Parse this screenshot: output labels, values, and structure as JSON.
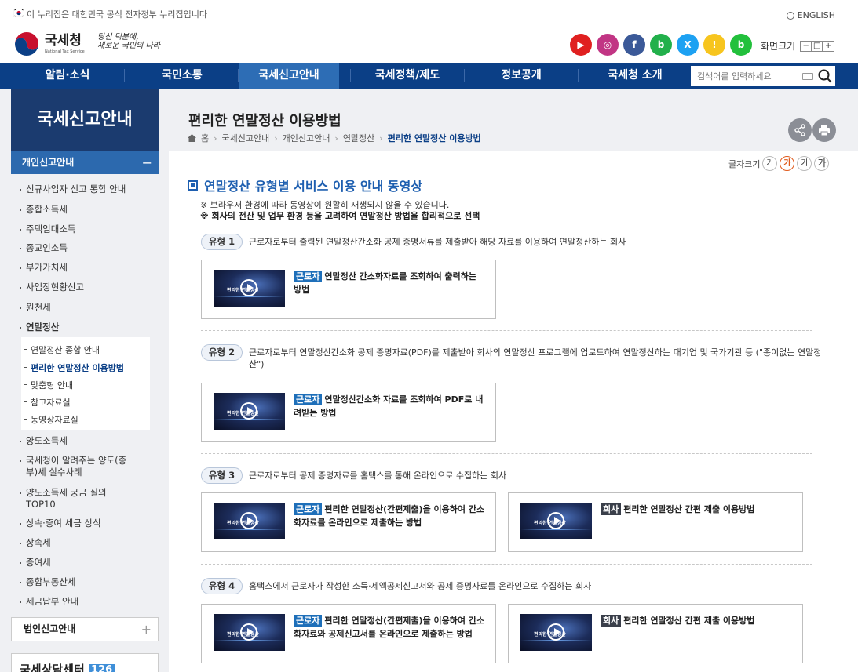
{
  "gov_banner": {
    "text": "이 누리집은 대한민국 공식 전자정부 누리집입니다",
    "english": "ENGLISH"
  },
  "header": {
    "logo_name": "국세청",
    "logo_sub": "National Tax Service",
    "slogan_line1": "당신 덕분에,",
    "slogan_line2": "새로운 국민의 나라",
    "font_size_label": "화면크기",
    "font_size_buttons": [
      "−",
      "□",
      "+"
    ],
    "social": [
      {
        "name": "youtube",
        "color": "#e02020",
        "glyph": "▶"
      },
      {
        "name": "instagram",
        "color": "#c13584",
        "glyph": "◎"
      },
      {
        "name": "facebook",
        "color": "#3b5998",
        "glyph": "f"
      },
      {
        "name": "blog",
        "color": "#22b04b",
        "glyph": "b"
      },
      {
        "name": "x",
        "color": "#1da1f2",
        "glyph": "X"
      },
      {
        "name": "kakao",
        "color": "#f7c51e",
        "glyph": "!"
      },
      {
        "name": "band",
        "color": "#22c03c",
        "glyph": "b"
      }
    ]
  },
  "gnb": {
    "items": [
      "알림·소식",
      "국민소통",
      "국세신고안내",
      "국세정책/제도",
      "정보공개",
      "국세청 소개"
    ],
    "active_index": 2,
    "search_placeholder": "검색어를 입력하세요"
  },
  "lnb": {
    "title": "국세신고안내",
    "section": "개인신고안내",
    "items": [
      "신규사업자 신고 통합 안내",
      "종합소득세",
      "주택임대소득",
      "종교인소득",
      "부가가치세",
      "사업장현황신고",
      "원천세",
      "연말정산"
    ],
    "sub_items": [
      "연말정산 종합 안내",
      "편리한 연말정산 이용방법",
      "맞춤형 안내",
      "참고자료실",
      "동영상자료실"
    ],
    "current_sub": 1,
    "items_after": [
      "양도소득세",
      "국세청이 알려주는 양도(종부)세 실수사례",
      "양도소득세 궁금 질의 TOP10",
      "상속·증여 세금 상식",
      "상속세",
      "증여세",
      "종합부동산세",
      "세금납부 안내"
    ],
    "box_corp": "법인신고안내",
    "call_center": "국세상담센터",
    "call_number": "126"
  },
  "content": {
    "page_title": "편리한 연말정산 이용방법",
    "breadcrumb": [
      "홈",
      "국세신고안내",
      "개인신고안내",
      "연말정산",
      "편리한 연말정산 이용방법"
    ],
    "text_size_label": "글자크기",
    "text_size_buttons": [
      "가",
      "가",
      "가",
      "가"
    ],
    "section_title": "연말정산 유형별 서비스 이용 안내 동영상",
    "note1": "※ 브라우저 환경에 따라 동영상이 원활히 재생되지 않을 수 있습니다.",
    "note2": "※ 회사의 전산 및 업무 환경 등을 고려하여 연말정산 방법을 합리적으로 선택",
    "thumb_title": "편리한 연말정산",
    "types": [
      {
        "label": "유형 1",
        "desc": "근로자로부터 출력된 연말정산간소화 공제 증명서류를 제출받아 해당 자료를 이용하여 연말정산하는 회사",
        "cards": [
          {
            "badge": "근로자",
            "kind": "worker",
            "text": "연말정산 간소화자료를 조회하여 출력하는 방법"
          }
        ]
      },
      {
        "label": "유형 2",
        "desc": "근로자로부터 연말정산간소화 공제 증명자료(PDF)를 제출받아 회사의 연말정산 프로그램에 업로드하여 연말정산하는 대기업 및 국가기관 등 (\"종이없는 연말정산\")",
        "cards": [
          {
            "badge": "근로자",
            "kind": "worker",
            "text": "연말정산간소화 자료를 조회하여 PDF로 내려받는 방법"
          }
        ]
      },
      {
        "label": "유형 3",
        "desc": "근로자로부터 공제 증명자료를 홈택스를 통해 온라인으로 수집하는 회사",
        "cards": [
          {
            "badge": "근로자",
            "kind": "worker",
            "text": "편리한 연말정산(간편제출)을 이용하여 간소화자료를 온라인으로 제출하는 방법"
          },
          {
            "badge": "회사",
            "kind": "company",
            "text": "편리한 연말정산 간편 제출 이용방법"
          }
        ]
      },
      {
        "label": "유형 4",
        "desc": "홈택스에서 근로자가 작성한 소득·세액공제신고서와 공제 증명자료를 온라인으로 수집하는 회사",
        "cards": [
          {
            "badge": "근로자",
            "kind": "worker",
            "text": "편리한 연말정산(간편제출)을 이용하여 간소화자료와 공제신고서를 온라인으로 제출하는 방법"
          },
          {
            "badge": "회사",
            "kind": "company",
            "text": "편리한 연말정산 간편 제출 이용방법"
          }
        ]
      }
    ]
  }
}
